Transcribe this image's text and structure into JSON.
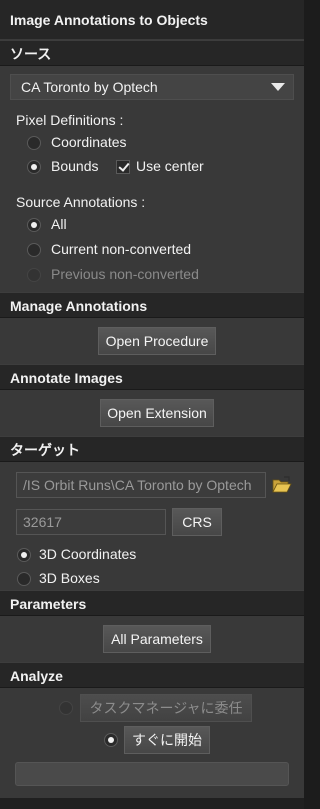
{
  "panel": {
    "title": "Image Annotations to Objects"
  },
  "source": {
    "header": "ソース",
    "combo_value": "CA Toronto by Optech",
    "pixel_def_label": "Pixel Definitions :",
    "coords_label": "Coordinates",
    "bounds_label": "Bounds",
    "use_center_label": "Use center",
    "source_ann_label": "Source Annotations :",
    "all_label": "All",
    "current_label": "Current non-converted",
    "previous_label": "Previous non-converted"
  },
  "manage": {
    "header": "Manage Annotations",
    "button": "Open Procedure"
  },
  "annotate": {
    "header": "Annotate Images",
    "button": "Open Extension"
  },
  "target": {
    "header": "ターゲット",
    "path_value": "/IS Orbit Runs\\CA Toronto by Optech",
    "crs_value": "32617",
    "crs_button": "CRS",
    "coords3d_label": "3D Coordinates",
    "boxes3d_label": "3D Boxes"
  },
  "parameters": {
    "header": "Parameters",
    "button": "All Parameters"
  },
  "analyze": {
    "header": "Analyze",
    "task_manager_label": "タスクマネージャに委任",
    "start_now_label": "すぐに開始"
  },
  "colors": {
    "panel": "#202020",
    "section_body": "#393939",
    "text": "#f2f2f2",
    "disabled_text": "#8a8a8a"
  }
}
